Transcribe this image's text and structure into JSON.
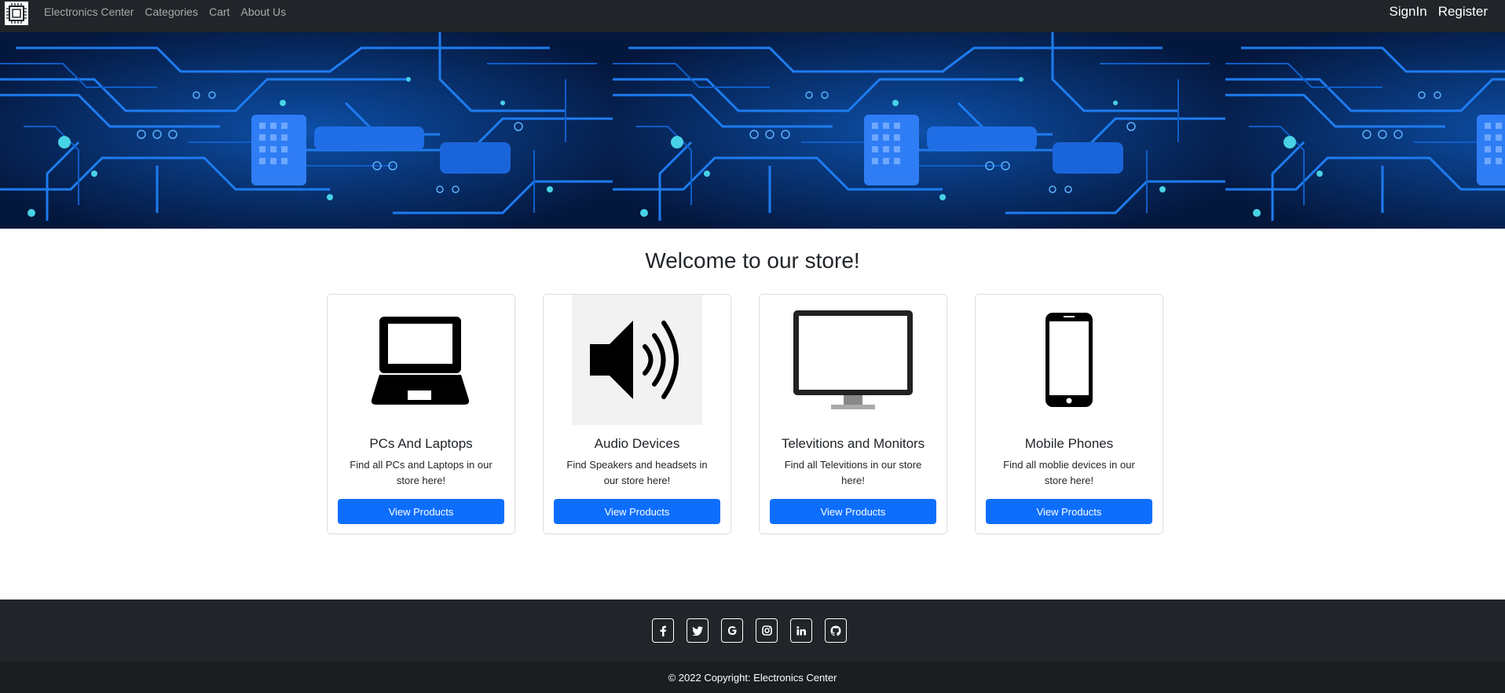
{
  "navbar": {
    "logo_icon": "chip-icon",
    "brand": "Electronics Center",
    "links": [
      "Categories",
      "Cart",
      "About Us"
    ],
    "signin": "SignIn",
    "register": "Register"
  },
  "hero": {
    "image": "circuit-board-banner"
  },
  "main": {
    "heading": "Welcome to our store!",
    "cards": [
      {
        "icon": "laptop-icon",
        "title": "PCs And Laptops",
        "text": "Find all PCs and Laptops in our store here!",
        "button": "View Products"
      },
      {
        "icon": "speaker-icon",
        "title": "Audio Devices",
        "text": "Find Speakers and headsets in our store here!",
        "button": "View Products"
      },
      {
        "icon": "monitor-icon",
        "title": "Televitions and Monitors",
        "text": "Find all Televitions in our store here!",
        "button": "View Products"
      },
      {
        "icon": "smartphone-icon",
        "title": "Mobile Phones",
        "text": "Find all moblie devices in our store here!",
        "button": "View Products"
      }
    ]
  },
  "footer": {
    "social": [
      "facebook-icon",
      "twitter-icon",
      "google-icon",
      "instagram-icon",
      "linkedin-icon",
      "github-icon"
    ],
    "copyright": "© 2022 Copyright: Electronics Center"
  },
  "colors": {
    "navbar_bg": "#212529",
    "primary_button": "#0d6efd",
    "footer_bg": "#212529",
    "copyright_bg": "#1b1e21"
  }
}
